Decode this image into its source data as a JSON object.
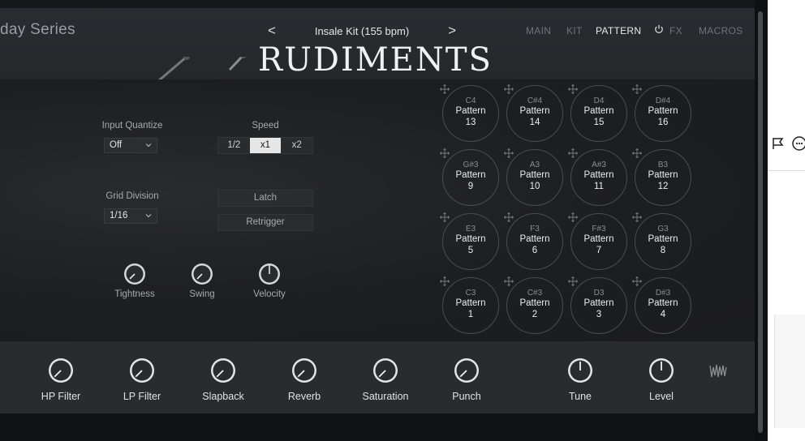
{
  "header": {
    "series_title": "day Series",
    "preset_name": "Insale Kit (155 bpm)",
    "prev_arrow": "<",
    "next_arrow": ">",
    "nav": [
      {
        "label": "MAIN"
      },
      {
        "label": "KIT"
      },
      {
        "label": "PATTERN"
      },
      {
        "label": "FX"
      },
      {
        "label": "MACROS"
      }
    ],
    "active_nav": "PATTERN",
    "instrument_title": "RUDIMENTS"
  },
  "controls": {
    "input_quantize": {
      "label": "Input Quantize",
      "value": "Off"
    },
    "grid_division": {
      "label": "Grid Division",
      "value": "1/16"
    },
    "speed": {
      "label": "Speed",
      "options": [
        "1/2",
        "x1",
        "x2"
      ],
      "selected": "x1"
    },
    "latch_label": "Latch",
    "retrigger_label": "Retrigger",
    "knobs": [
      {
        "label": "Tightness"
      },
      {
        "label": "Swing"
      },
      {
        "label": "Velocity"
      }
    ]
  },
  "pads": [
    {
      "note": "C4",
      "name": "Pattern",
      "num": "13"
    },
    {
      "note": "C#4",
      "name": "Pattern",
      "num": "14"
    },
    {
      "note": "D4",
      "name": "Pattern",
      "num": "15"
    },
    {
      "note": "D#4",
      "name": "Pattern",
      "num": "16"
    },
    {
      "note": "G#3",
      "name": "Pattern",
      "num": "9"
    },
    {
      "note": "A3",
      "name": "Pattern",
      "num": "10"
    },
    {
      "note": "A#3",
      "name": "Pattern",
      "num": "11"
    },
    {
      "note": "B3",
      "name": "Pattern",
      "num": "12"
    },
    {
      "note": "E3",
      "name": "Pattern",
      "num": "5"
    },
    {
      "note": "F3",
      "name": "Pattern",
      "num": "6"
    },
    {
      "note": "F#3",
      "name": "Pattern",
      "num": "7"
    },
    {
      "note": "G3",
      "name": "Pattern",
      "num": "8"
    },
    {
      "note": "C3",
      "name": "Pattern",
      "num": "1"
    },
    {
      "note": "C#3",
      "name": "Pattern",
      "num": "2"
    },
    {
      "note": "D3",
      "name": "Pattern",
      "num": "3"
    },
    {
      "note": "D#3",
      "name": "Pattern",
      "num": "4"
    }
  ],
  "macros": [
    {
      "label": "HP Filter"
    },
    {
      "label": "LP Filter"
    },
    {
      "label": "Slapback"
    },
    {
      "label": "Reverb"
    },
    {
      "label": "Saturation"
    },
    {
      "label": "Punch"
    },
    {
      "label": "Tune"
    },
    {
      "label": "Level"
    }
  ],
  "colors": {
    "background": "#1d1e21",
    "header": "#2a2c31",
    "bottom_bar": "#2a2b2f",
    "text": "#e6e6e6"
  }
}
